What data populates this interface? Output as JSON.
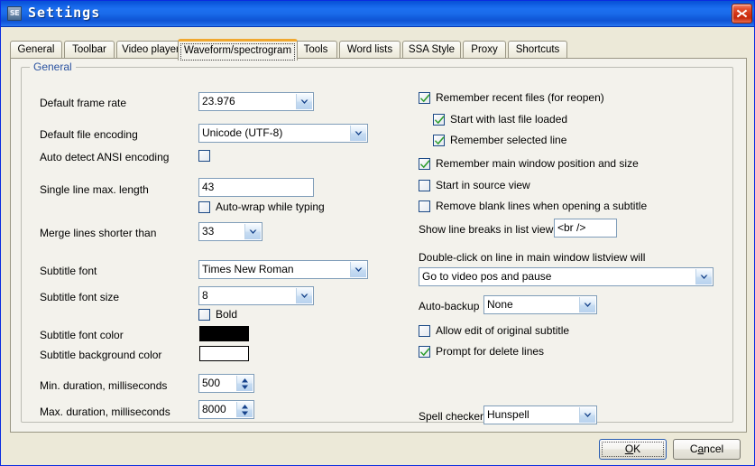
{
  "window": {
    "title": "Settings",
    "app_icon": "SE",
    "close_icon": "close-icon",
    "accent_title_blue": "#1464e6",
    "dialog_background": "#ece9d8",
    "panel_background": "#f3f2ec"
  },
  "tabs": [
    {
      "label": "General",
      "active": false
    },
    {
      "label": "Toolbar",
      "active": false
    },
    {
      "label": "Video player",
      "active": false
    },
    {
      "label": "Waveform/spectrogram",
      "active": true
    },
    {
      "label": "Tools",
      "active": false
    },
    {
      "label": "Word lists",
      "active": false
    },
    {
      "label": "SSA Style",
      "active": false
    },
    {
      "label": "Proxy",
      "active": false
    },
    {
      "label": "Shortcuts",
      "active": false
    }
  ],
  "group": {
    "label": "General",
    "label_color": "#2a52a0"
  },
  "left": {
    "default_frame_rate": {
      "label": "Default frame rate",
      "value": "23.976"
    },
    "default_file_encoding": {
      "label": "Default file encoding",
      "value": "Unicode (UTF-8)"
    },
    "auto_detect_ansi": {
      "label": "Auto detect ANSI encoding",
      "checked": false
    },
    "single_line_max_length": {
      "label": "Single line max. length",
      "value": "43"
    },
    "auto_wrap": {
      "label": "Auto-wrap while typing",
      "checked": false
    },
    "merge_lines_shorter_than": {
      "label": "Merge lines shorter than",
      "value": "33"
    },
    "subtitle_font": {
      "label": "Subtitle font",
      "value": "Times New Roman"
    },
    "subtitle_font_size": {
      "label": "Subtitle font size",
      "value": "8"
    },
    "bold": {
      "label": "Bold",
      "checked": false
    },
    "subtitle_font_color": {
      "label": "Subtitle font color",
      "color": "#000000"
    },
    "subtitle_background_color": {
      "label": "Subtitle background color",
      "color": "#ffffff"
    },
    "min_duration": {
      "label": "Min. duration, milliseconds",
      "value": "500"
    },
    "max_duration": {
      "label": "Max. duration, milliseconds",
      "value": "8000"
    }
  },
  "right": {
    "remember_recent_files": {
      "label": "Remember recent files (for reopen)",
      "checked": true
    },
    "start_with_last_file": {
      "label": "Start with last file loaded",
      "checked": true
    },
    "remember_selected_line": {
      "label": "Remember selected line",
      "checked": true
    },
    "remember_main_window": {
      "label": "Remember main window position and size",
      "checked": true
    },
    "start_in_source_view": {
      "label": "Start in source view",
      "checked": false
    },
    "remove_blank_lines": {
      "label": "Remove blank lines when opening a subtitle",
      "checked": false
    },
    "show_line_breaks": {
      "label": "Show line breaks in list view as",
      "value": "<br />"
    },
    "double_click": {
      "label": "Double-click on line in main window listview will",
      "value": "Go to video pos and pause"
    },
    "auto_backup": {
      "label": "Auto-backup",
      "value": "None"
    },
    "allow_edit_original": {
      "label": "Allow edit of original subtitle",
      "checked": false
    },
    "prompt_delete_lines": {
      "label": "Prompt for delete lines",
      "checked": true
    },
    "spell_checker": {
      "label": "Spell checker",
      "value": "Hunspell"
    }
  },
  "footer": {
    "ok": {
      "prefix": "",
      "accel": "O",
      "suffix": "K"
    },
    "cancel": {
      "prefix": "C",
      "accel": "a",
      "suffix": "ncel"
    }
  }
}
